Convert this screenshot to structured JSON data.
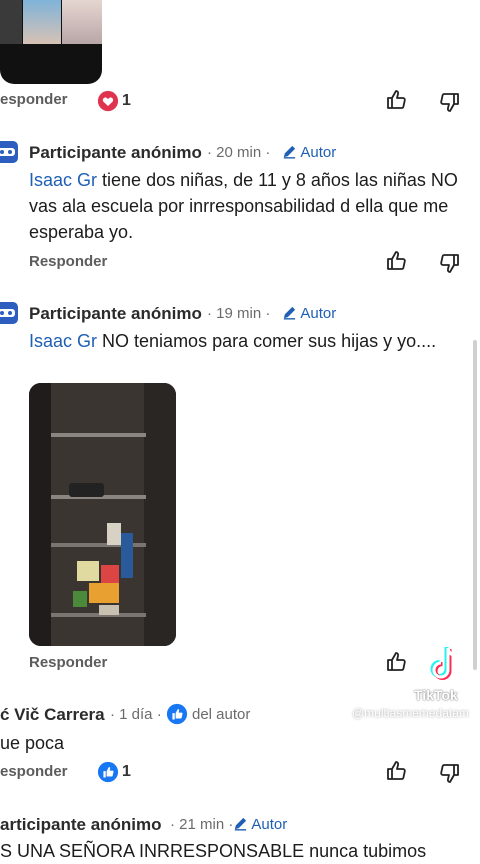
{
  "comments": [
    {
      "reply_label": "esponder",
      "reaction_count": "1"
    },
    {
      "author": "Participante anónimo",
      "time": "· 20 min ·",
      "badge": "Autor",
      "mention": "Isaac Gr",
      "text": " tiene dos niñas, de 11 y 8 años las niñas NO vas ala escuela por inrresponsabilidad d ella que me esperaba yo.",
      "reply_label": "Responder"
    },
    {
      "author": "Participante anónimo",
      "time": "· 19 min ·",
      "badge": "Autor",
      "mention": "Isaac Gr",
      "text": " NO teniamos para comer sus hijas y yo....",
      "reply_label": "Responder"
    },
    {
      "author": "ć Vič Carrera",
      "time": "· 1 día ·",
      "badge": "del autor",
      "text": "ue poca",
      "reply_label": "esponder",
      "reaction_count": "1"
    },
    {
      "author": "articipante anónimo",
      "time": "· 21 min ·",
      "badge": "Autor",
      "text": "S UNA SEÑORA INRRESPONSABLE nunca tubimos"
    }
  ],
  "watermark": {
    "brand": "TikTok",
    "handle": "@multiasmemedatam"
  },
  "colors": {
    "accent": "#1f5fb4",
    "heart": "#e0344e",
    "like": "#1877f2"
  }
}
